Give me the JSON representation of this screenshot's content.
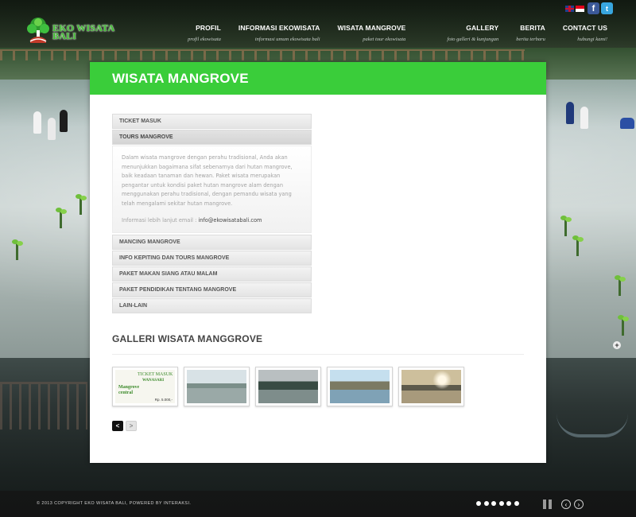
{
  "logo": {
    "line1": "EKO WISATA",
    "line2": "BALI"
  },
  "nav": [
    {
      "label": "PROFIL",
      "sub": "profil ekowisata"
    },
    {
      "label": "INFORMASI EKOWISATA",
      "sub": "informasi umum ekowisata bali"
    },
    {
      "label": "WISATA MANGROVE",
      "sub": "paket tour ekowisata"
    },
    {
      "label": "GALLERY",
      "sub": "foto galleri & kunjungan"
    },
    {
      "label": "BERITA",
      "sub": "berita terbaru"
    },
    {
      "label": "CONTACT US",
      "sub": "hubungi kami!"
    }
  ],
  "social": {
    "facebook": "f",
    "twitter": "t"
  },
  "page": {
    "title": "WISATA MANGROVE"
  },
  "accordion": {
    "items": [
      {
        "label": "TICKET MASUK"
      },
      {
        "label": "TOURS MANGROVE"
      },
      {
        "label": "MANCING MANGROVE"
      },
      {
        "label": "INFO KEPITING DAN TOURS MANGROVE"
      },
      {
        "label": "PAKET MAKAN SIANG ATAU MALAM"
      },
      {
        "label": "PAKET PENDIDIKAN TENTANG MANGROVE"
      },
      {
        "label": "LAIN-LAIN"
      }
    ],
    "open_body": {
      "text": "Dalam wisata mangrove dengan perahu tradisional, Anda akan menunjukkan bagaimana sifat sebenarnya dari hutan mangrove, baik keadaan tanaman dan hewan. Paket wisata merupakan pengantar untuk kondisi paket hutan mangrove alam dengan menggunakan perahu tradisional, dengan pemandu wisata yang telah mengalami sekitar hutan mangrove.",
      "contact_prefix": "Informasi lebih lanjut email : ",
      "email": "info@ekowisatabali.com"
    }
  },
  "gallery": {
    "title": "GALLERI WISATA MANGGROVE",
    "ticket_thumb": {
      "line1": "TICKET MASUK",
      "line2": "WANASARI",
      "line3": "Mangrove",
      "line4": "central",
      "price": "Rp. 5.000,-"
    },
    "prev_label": "<",
    "next_label": ">"
  },
  "footer": {
    "copyright": "© 2013 COPYRIGHT EKO WISATA BALI, POWERED BY INTERAKSI.",
    "prev_arrow": "‹",
    "next_arrow": "›"
  },
  "slider": {
    "plus": "+"
  },
  "colors": {
    "accent": "#3acd3a",
    "title_text": "#ffffff"
  }
}
